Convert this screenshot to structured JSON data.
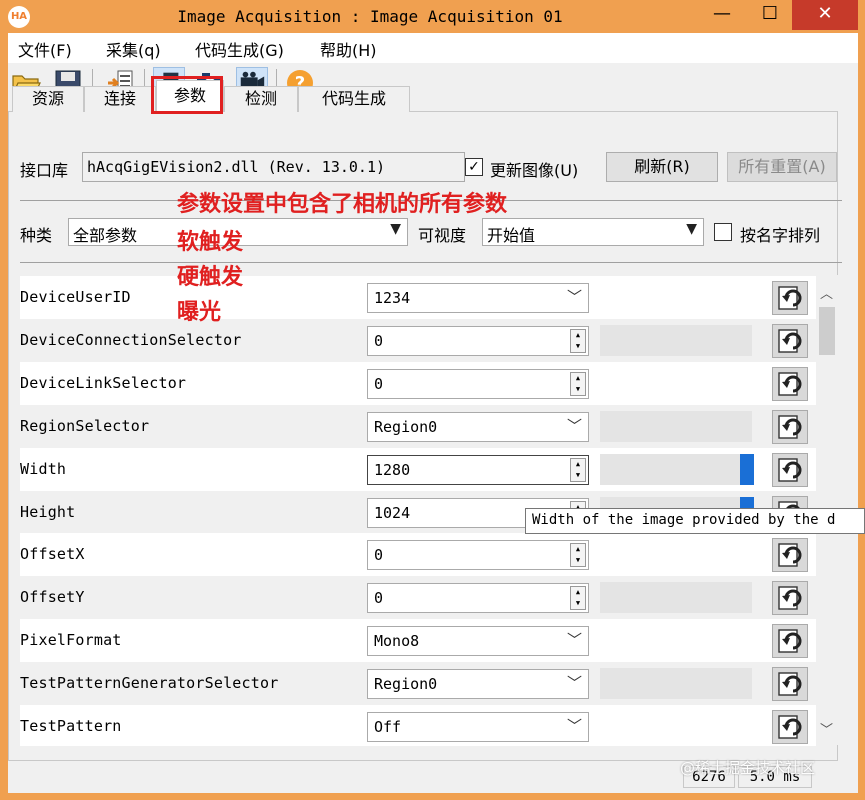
{
  "window": {
    "app_icon": "HA",
    "title": "Image Acquisition : Image Acquisition 01",
    "minimize": "—",
    "maximize": "☐",
    "close": "✕"
  },
  "menu": [
    "文件(F)",
    "采集(q)",
    "代码生成(G)",
    "帮助(H)"
  ],
  "toolbar": {
    "icons": [
      "open-folder-icon",
      "save-icon",
      "import-icon",
      "connect-icon",
      "snap-camera-icon",
      "live-video-icon",
      "help-icon"
    ]
  },
  "tabs": [
    {
      "label": "资源"
    },
    {
      "label": "连接"
    },
    {
      "label": "参数"
    },
    {
      "label": "检测"
    },
    {
      "label": "代码生成"
    }
  ],
  "lib": {
    "label": "接口库",
    "value": "hAcqGigEVision2.dll (Rev. 13.0.1)",
    "update_image_label": "更新图像(U)",
    "update_image_checked": true,
    "refresh_button": "刷新(R)",
    "reset_all_button": "所有重置(A)"
  },
  "filter": {
    "category_label": "种类",
    "category_value": "全部参数",
    "visibility_label": "可视度",
    "visibility_value": "开始值",
    "sort_label": "按名字排列",
    "sort_checked": false
  },
  "annotation": {
    "lines": [
      "参数设置中包含了相机的所有参数",
      "软触发",
      "硬触发",
      "曝光"
    ],
    "color": "#e02020"
  },
  "parameters": [
    {
      "name": "DeviceUserID",
      "value": "1234",
      "control": "dropdown"
    },
    {
      "name": "DeviceConnectionSelector",
      "value": "0",
      "control": "spin"
    },
    {
      "name": "DeviceLinkSelector",
      "value": "0",
      "control": "spin"
    },
    {
      "name": "RegionSelector",
      "value": "Region0",
      "control": "dropdown"
    },
    {
      "name": "Width",
      "value": "1280",
      "control": "spin",
      "slider_level": 1.0
    },
    {
      "name": "Height",
      "value": "1024",
      "control": "spin",
      "slider_level": 1.0
    },
    {
      "name": "OffsetX",
      "value": "0",
      "control": "spin"
    },
    {
      "name": "OffsetY",
      "value": "0",
      "control": "spin"
    },
    {
      "name": "PixelFormat",
      "value": "Mono8",
      "control": "dropdown"
    },
    {
      "name": "TestPatternGeneratorSelector",
      "value": "Region0",
      "control": "dropdown"
    },
    {
      "name": "TestPattern",
      "value": "Off",
      "control": "dropdown"
    }
  ],
  "tooltip": "Width of the image provided by the d",
  "status": {
    "frame_count": "6276",
    "time": "5.0 ms"
  },
  "watermark": "@稀土掘金技术社区",
  "colors": {
    "title_bar": "#f0a050",
    "close_button": "#c63a2a",
    "highlight": "#e02020",
    "slider": "#1a6fd6"
  }
}
